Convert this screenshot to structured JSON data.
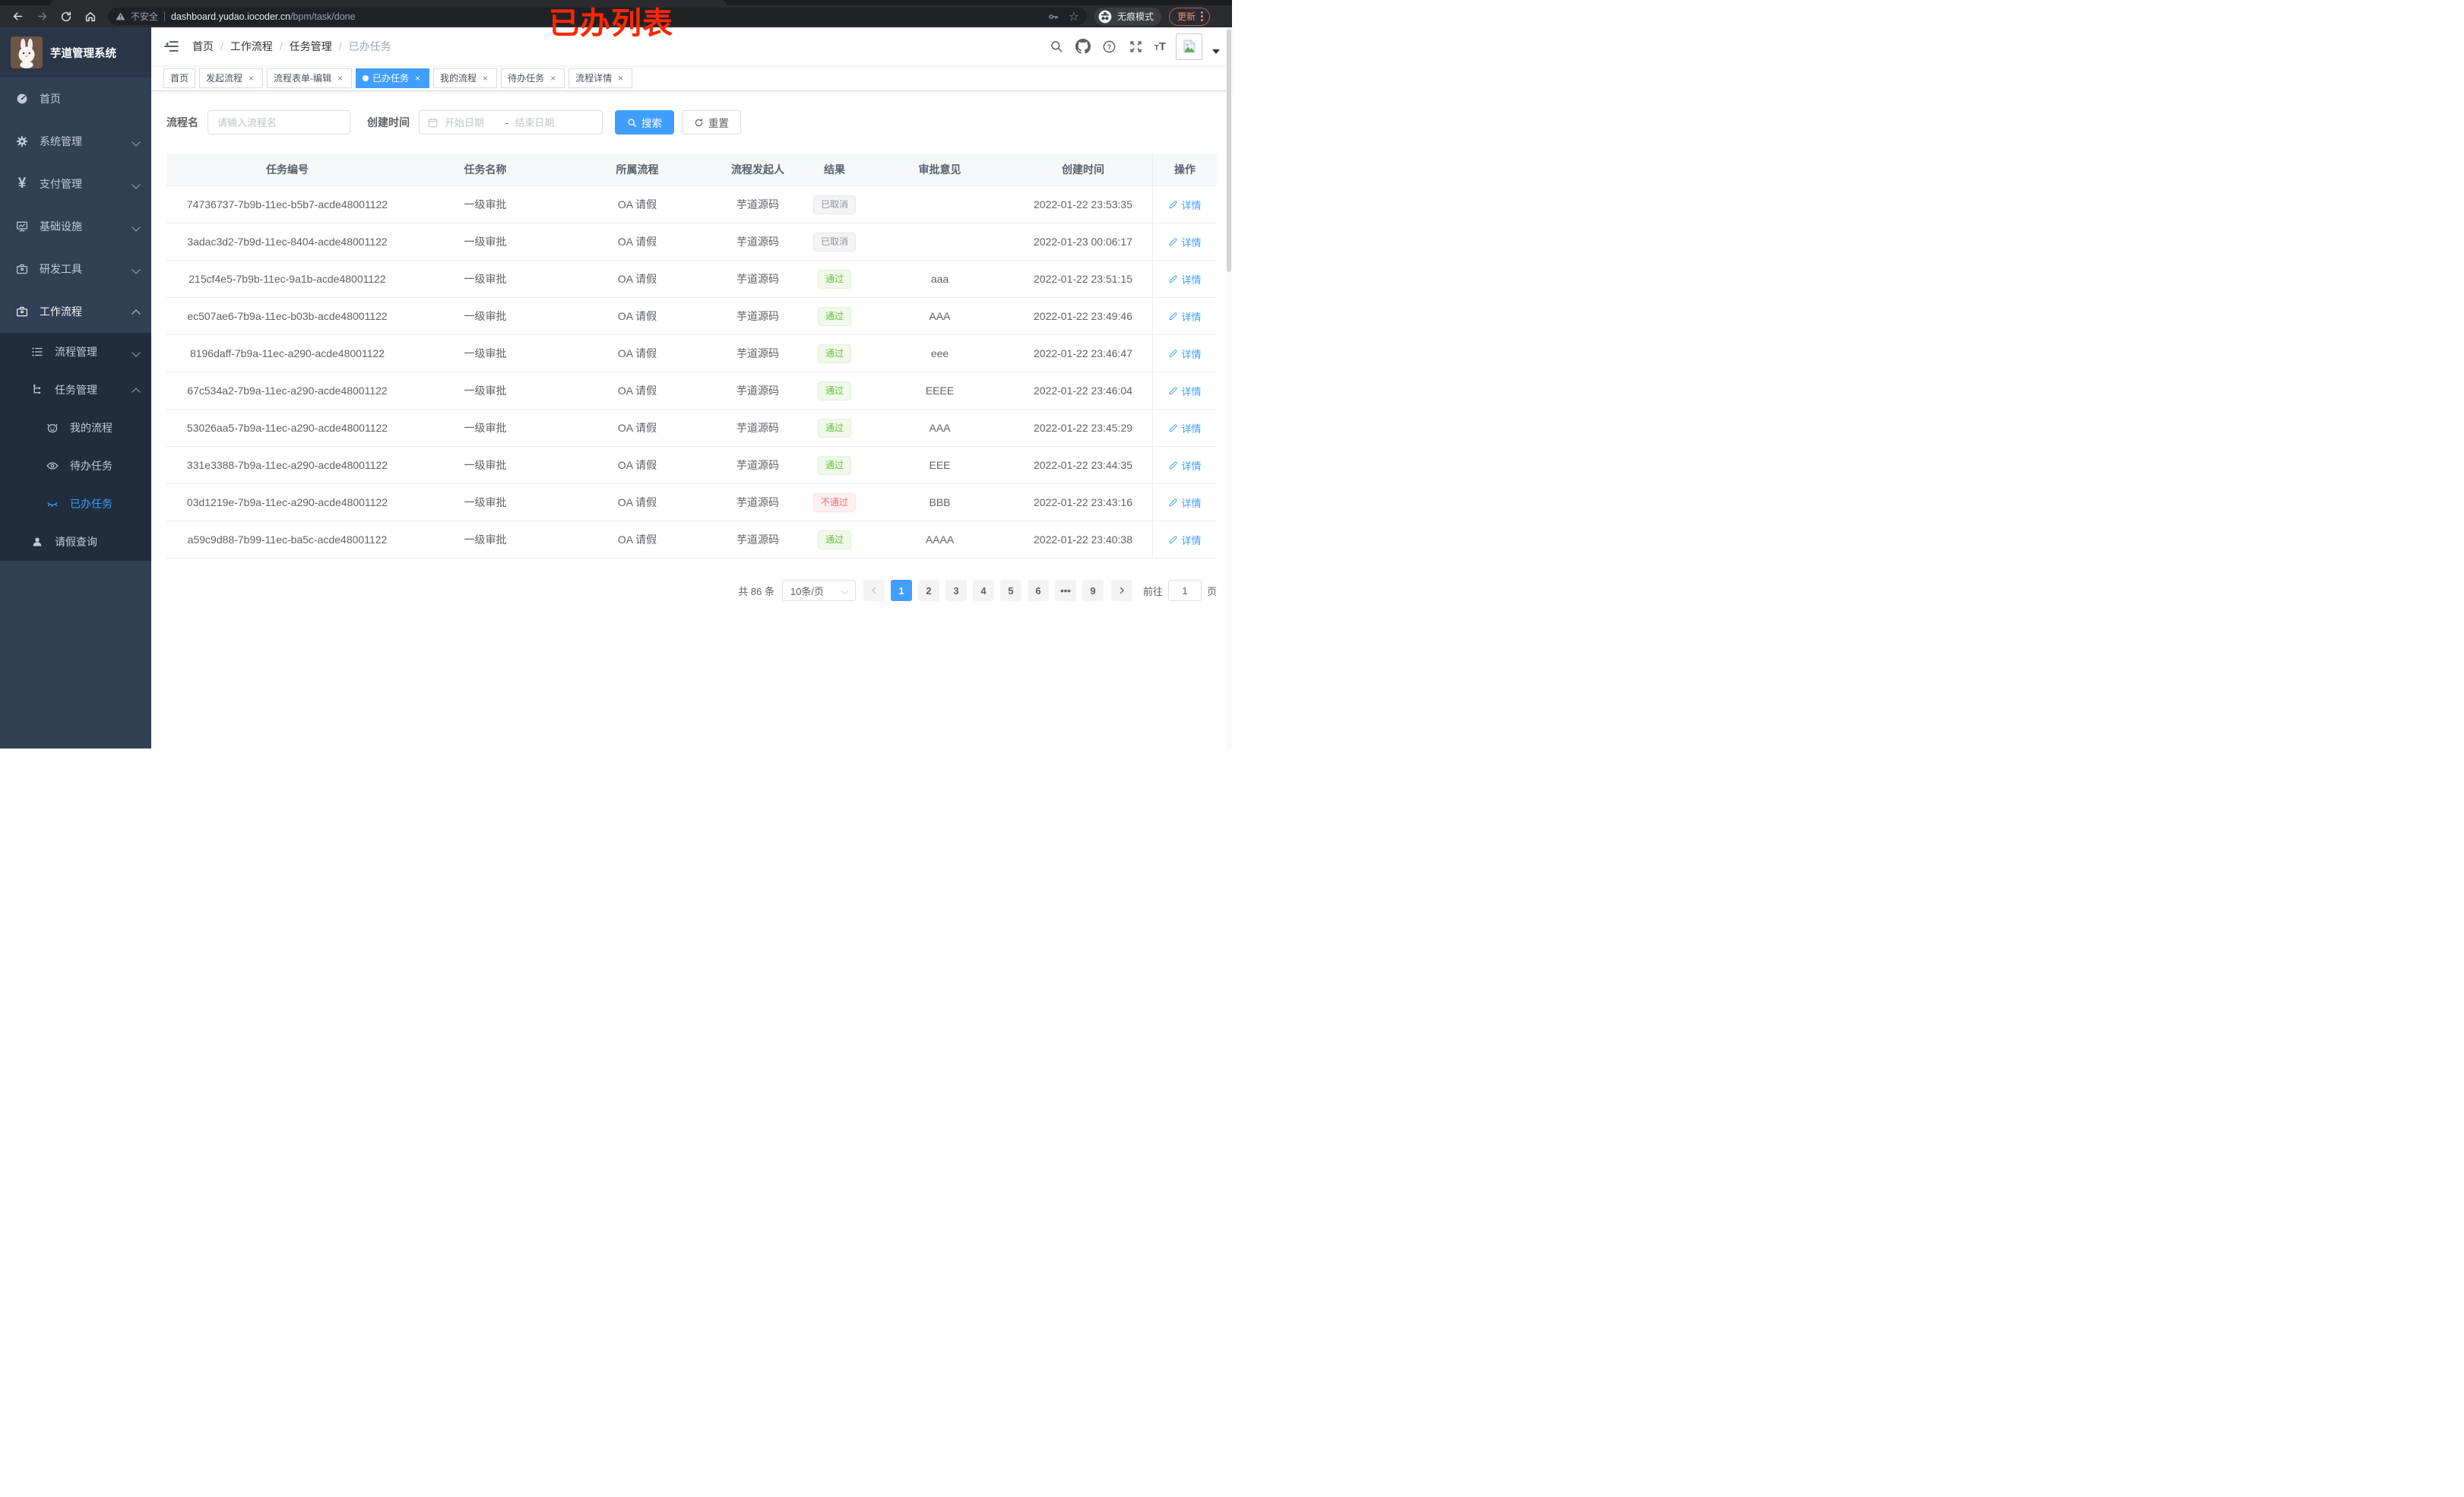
{
  "browser": {
    "security_label": "不安全",
    "url_host": "dashboard.yudao.iocoder.cn",
    "url_path": "/bpm/task/done",
    "incognito_label": "无痕模式",
    "update_label": "更新"
  },
  "annotation": "已办列表",
  "app_title": "芋道管理系统",
  "breadcrumb": {
    "items": [
      "首页",
      "工作流程",
      "任务管理"
    ],
    "current": "已办任务",
    "separator": "/"
  },
  "sidebar": {
    "items": [
      {
        "label": "首页"
      },
      {
        "label": "系统管理"
      },
      {
        "label": "支付管理"
      },
      {
        "label": "基础设施"
      },
      {
        "label": "研发工具"
      },
      {
        "label": "工作流程"
      },
      {
        "label": "流程管理"
      },
      {
        "label": "任务管理"
      },
      {
        "label": "我的流程"
      },
      {
        "label": "待办任务"
      },
      {
        "label": "已办任务"
      },
      {
        "label": "请假查询"
      }
    ]
  },
  "tabs": [
    {
      "label": "首页",
      "closable": false,
      "active": false
    },
    {
      "label": "发起流程",
      "closable": true,
      "active": false
    },
    {
      "label": "流程表单-编辑",
      "closable": true,
      "active": false
    },
    {
      "label": "已办任务",
      "closable": true,
      "active": true
    },
    {
      "label": "我的流程",
      "closable": true,
      "active": false
    },
    {
      "label": "待办任务",
      "closable": true,
      "active": false
    },
    {
      "label": "流程详情",
      "closable": true,
      "active": false
    }
  ],
  "filters": {
    "name_label": "流程名",
    "name_placeholder": "请输入流程名",
    "time_label": "创建时间",
    "start_placeholder": "开始日期",
    "range_separator": "-",
    "end_placeholder": "结束日期",
    "search_label": "搜索",
    "reset_label": "重置"
  },
  "table": {
    "columns": [
      "任务编号",
      "任务名称",
      "所属流程",
      "流程发起人",
      "结果",
      "审批意见",
      "创建时间",
      "操作"
    ],
    "detail_label": "详情",
    "rows": [
      {
        "id": "74736737-7b9b-11ec-b5b7-acde48001122",
        "name": "一级审批",
        "process": "OA 请假",
        "starter": "芋道源码",
        "result": "已取消",
        "result_type": "info",
        "opinion": "",
        "time": "2022-01-22 23:53:35"
      },
      {
        "id": "3adac3d2-7b9d-11ec-8404-acde48001122",
        "name": "一级审批",
        "process": "OA 请假",
        "starter": "芋道源码",
        "result": "已取消",
        "result_type": "info",
        "opinion": "",
        "time": "2022-01-23 00:06:17"
      },
      {
        "id": "215cf4e5-7b9b-11ec-9a1b-acde48001122",
        "name": "一级审批",
        "process": "OA 请假",
        "starter": "芋道源码",
        "result": "通过",
        "result_type": "success",
        "opinion": "aaa",
        "time": "2022-01-22 23:51:15"
      },
      {
        "id": "ec507ae6-7b9a-11ec-b03b-acde48001122",
        "name": "一级审批",
        "process": "OA 请假",
        "starter": "芋道源码",
        "result": "通过",
        "result_type": "success",
        "opinion": "AAA",
        "time": "2022-01-22 23:49:46"
      },
      {
        "id": "8196daff-7b9a-11ec-a290-acde48001122",
        "name": "一级审批",
        "process": "OA 请假",
        "starter": "芋道源码",
        "result": "通过",
        "result_type": "success",
        "opinion": "eee",
        "time": "2022-01-22 23:46:47"
      },
      {
        "id": "67c534a2-7b9a-11ec-a290-acde48001122",
        "name": "一级审批",
        "process": "OA 请假",
        "starter": "芋道源码",
        "result": "通过",
        "result_type": "success",
        "opinion": "EEEE",
        "time": "2022-01-22 23:46:04"
      },
      {
        "id": "53026aa5-7b9a-11ec-a290-acde48001122",
        "name": "一级审批",
        "process": "OA 请假",
        "starter": "芋道源码",
        "result": "通过",
        "result_type": "success",
        "opinion": "AAA",
        "time": "2022-01-22 23:45:29"
      },
      {
        "id": "331e3388-7b9a-11ec-a290-acde48001122",
        "name": "一级审批",
        "process": "OA 请假",
        "starter": "芋道源码",
        "result": "通过",
        "result_type": "success",
        "opinion": "EEE",
        "time": "2022-01-22 23:44:35"
      },
      {
        "id": "03d1219e-7b9a-11ec-a290-acde48001122",
        "name": "一级审批",
        "process": "OA 请假",
        "starter": "芋道源码",
        "result": "不通过",
        "result_type": "danger",
        "opinion": "BBB",
        "time": "2022-01-22 23:43:16"
      },
      {
        "id": "a59c9d88-7b99-11ec-ba5c-acde48001122",
        "name": "一级审批",
        "process": "OA 请假",
        "starter": "芋道源码",
        "result": "通过",
        "result_type": "success",
        "opinion": "AAAA",
        "time": "2022-01-22 23:40:38"
      }
    ]
  },
  "pagination": {
    "total_text": "共 86 条",
    "page_size_value": "10条/页",
    "pages": [
      "1",
      "2",
      "3",
      "4",
      "5",
      "6",
      "•••",
      "9"
    ],
    "active_page": "1",
    "goto_label": "前往",
    "goto_value": "1",
    "page_unit": "页"
  },
  "icons": {
    "close-icon": "×",
    "star-icon": "☆",
    "caret-down-icon": "▼",
    "active-tab-dot": "●",
    "prev-page-icon": "‹",
    "next-page-icon": "›",
    "range-separator": "-"
  },
  "colors": {
    "accent": "#409eff",
    "sidebar_bg": "#304156",
    "submenu_bg": "#1f2d3d",
    "tag_success": "#67c23a",
    "tag_danger": "#f56c6c",
    "tag_info": "#909399",
    "annotation_red": "#ff2600",
    "update_red": "#f28b82"
  }
}
